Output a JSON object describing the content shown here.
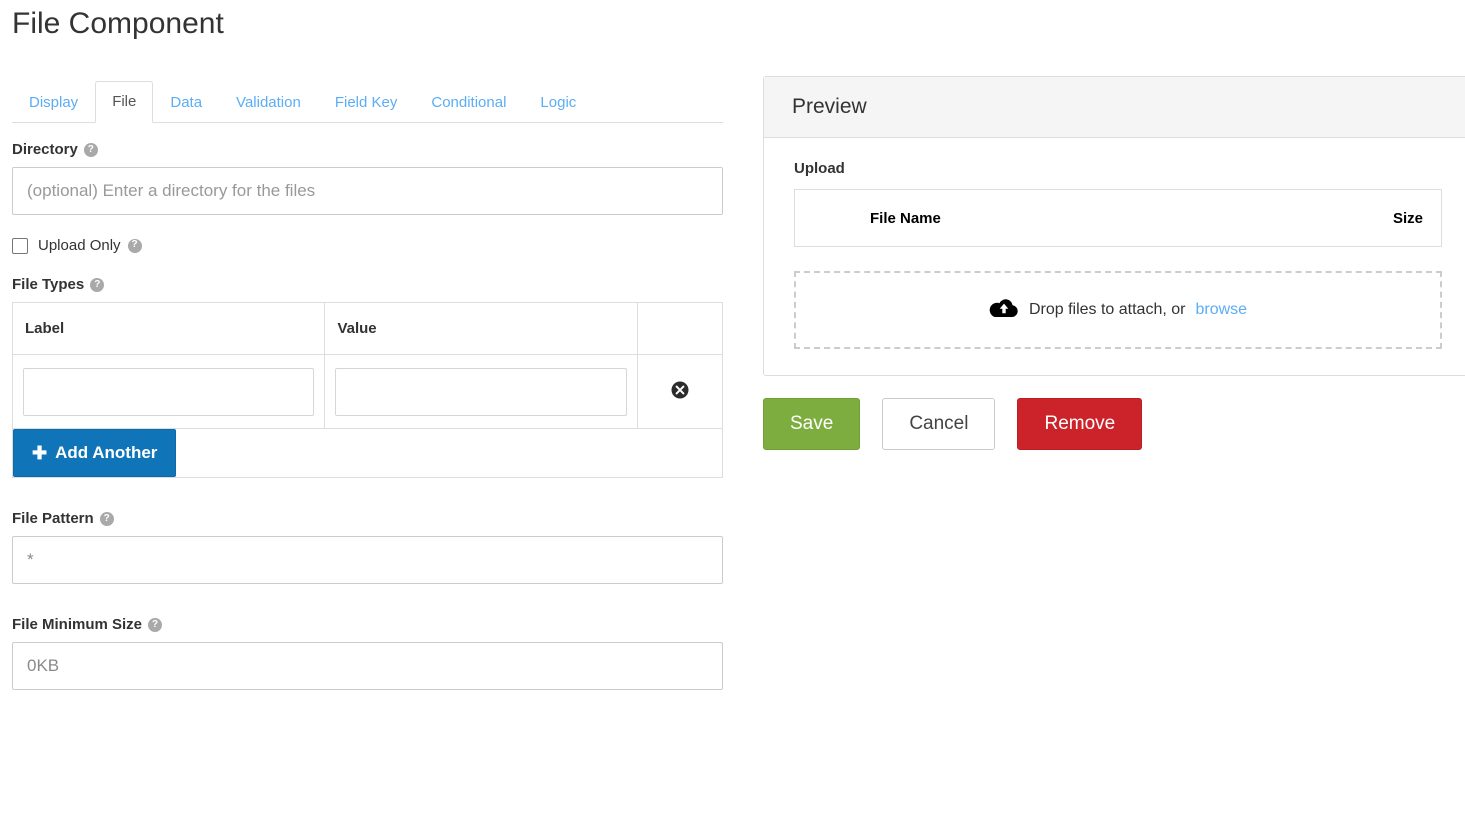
{
  "page": {
    "title": "File Component"
  },
  "tabs": [
    {
      "label": "Display",
      "active": false
    },
    {
      "label": "File",
      "active": true
    },
    {
      "label": "Data",
      "active": false
    },
    {
      "label": "Validation",
      "active": false
    },
    {
      "label": "Field Key",
      "active": false
    },
    {
      "label": "Conditional",
      "active": false
    },
    {
      "label": "Logic",
      "active": false
    }
  ],
  "form": {
    "directory": {
      "label": "Directory",
      "help_icon": "question-circle-icon",
      "value": "",
      "placeholder": "(optional) Enter a directory for the files"
    },
    "upload_only": {
      "label": "Upload Only",
      "checked": false,
      "help_icon": "question-circle-icon"
    },
    "file_types": {
      "label": "File Types",
      "help_icon": "question-circle-icon",
      "columns": [
        "Label",
        "Value",
        ""
      ],
      "rows": [
        {
          "label_value": "",
          "value_value": "",
          "remove_icon": "times-circle-icon"
        }
      ],
      "add_button": {
        "label": "Add Another",
        "icon": "plus-icon"
      }
    },
    "file_pattern": {
      "label": "File Pattern",
      "help_icon": "question-circle-icon",
      "value": "*"
    },
    "file_minimum_size": {
      "label": "File Minimum Size",
      "help_icon": "question-circle-icon",
      "value": "0KB"
    }
  },
  "preview": {
    "header": "Preview",
    "upload_label": "Upload",
    "file_table": {
      "file_name_header": "File Name",
      "size_header": "Size"
    },
    "dropzone": {
      "icon": "cloud-upload-icon",
      "text": "Drop files to attach, or",
      "link": "browse"
    }
  },
  "actions": {
    "save": "Save",
    "cancel": "Cancel",
    "remove": "Remove"
  },
  "colors": {
    "link": "#5badf5",
    "primary": "#1074b8",
    "save_green": "#7dad3e",
    "remove_red": "#cc2229",
    "border": "#dddddd",
    "panel_head_bg": "#f5f5f5"
  }
}
